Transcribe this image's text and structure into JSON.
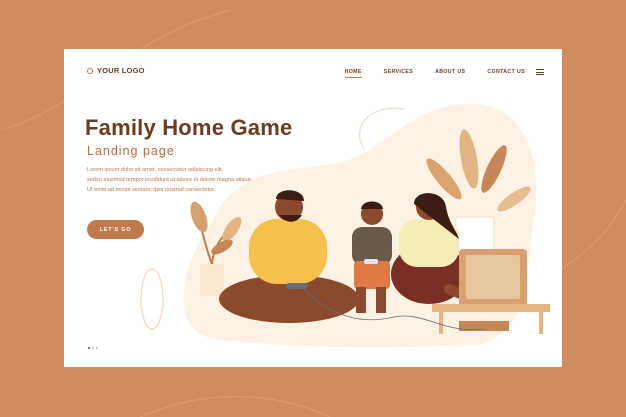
{
  "header": {
    "logo_text": "YOUR LOGO",
    "nav": [
      {
        "label": "HOME",
        "active": true
      },
      {
        "label": "SERVICES",
        "active": false
      },
      {
        "label": "ABOUT US",
        "active": false
      },
      {
        "label": "CONTACT US",
        "active": false
      }
    ]
  },
  "hero": {
    "title": "Family Home Game",
    "subtitle": "Landing page",
    "body_lines": [
      "Lorem ipsum dolor sit amet, consectetur adipiscing elit,",
      "sedso eiusmod tempor incididunt ut labore et dolore magna aliqua.",
      "Ut enim ad minim veniam, quis nostrud consectetur."
    ],
    "cta_label": "LET'S GO"
  },
  "pagination": {
    "total": 3,
    "active": 0
  },
  "colors": {
    "background": "#d28b5c",
    "card": "#ffffff",
    "heading": "#6a3d22",
    "accent": "#c07a4c"
  },
  "icons": [
    "logo-circle-icon",
    "hamburger-menu-icon"
  ]
}
